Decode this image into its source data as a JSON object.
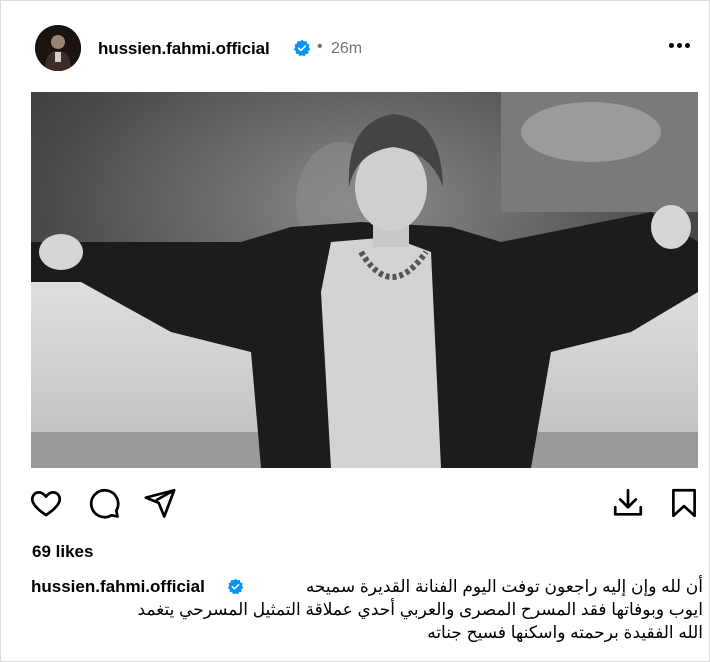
{
  "post": {
    "username": "hussien.fahmi.official",
    "time_separator": "•",
    "time_ago": "26m",
    "likes": "69 likes",
    "caption": {
      "line1": "أن لله وإن إليه راجعون توفت اليوم الفنانة القديرة سميحه",
      "line2": "ايوب وبوفاتها فقد المسرح المصرى والعربي أحدي عملاقة التمثيل المسرحي يتغمد",
      "line3": "الله الفقيدة برحمته واسكنها فسيح جناته"
    }
  },
  "icons": {
    "verified": "verified-badge-icon",
    "more": "more-options-icon",
    "like": "heart-icon",
    "comment": "comment-icon",
    "share": "share-icon",
    "download": "download-icon",
    "save": "bookmark-icon"
  },
  "colors": {
    "verified_blue": "#0095f6",
    "muted_text": "#737373",
    "text": "#000000"
  }
}
